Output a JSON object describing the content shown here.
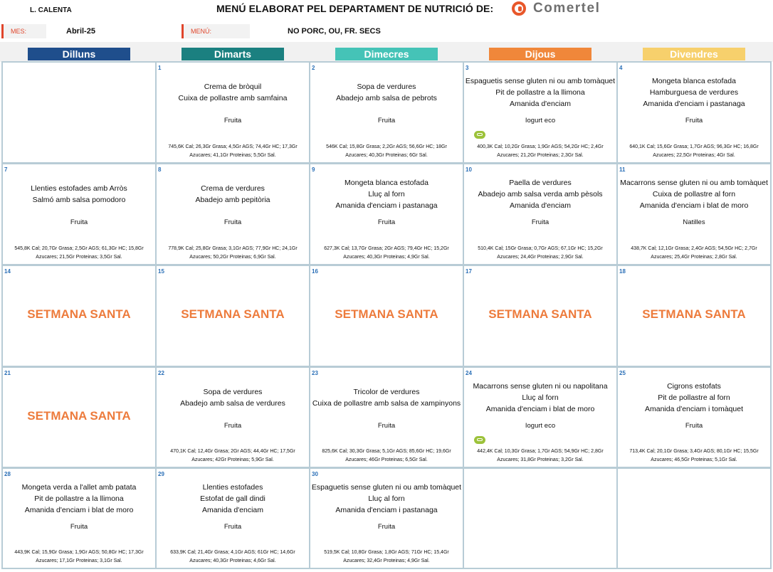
{
  "header": {
    "location": "L. CALENTA",
    "title": "MENÚ ELABORAT PEL DEPARTAMENT DE NUTRICIÓ DE:",
    "logo": "Comertel",
    "month_label": "MES:",
    "month_value": "Abril-25",
    "menu_label": "MENÚ:",
    "menu_value": "NO PORC, OU, FR. SECS"
  },
  "days": [
    {
      "label": "Dilluns",
      "color": "#1f4e8c"
    },
    {
      "label": "Dimarts",
      "color": "#1b8080"
    },
    {
      "label": "Dimecres",
      "color": "#45c3b7"
    },
    {
      "label": "Dijous",
      "color": "#f0873a"
    },
    {
      "label": "Divendres",
      "color": "#f7d06c"
    }
  ],
  "colors": {
    "holiday": "#ed7b3c",
    "day_number": "#2a6fb7",
    "accent": "#e0452b",
    "eco_badge": "#9cc23a"
  },
  "weeks": [
    [
      {
        "day": "",
        "dishes": [],
        "dessert": "",
        "nutrition": ""
      },
      {
        "day": "1",
        "dishes": [
          "Crema de bròquil",
          "Cuixa de pollastre amb samfaina"
        ],
        "dessert": "Fruita",
        "nutrition": "745,6K Cal; 26,3Gr Grasa; 4,5Gr AGS; 74,4Gr HC; 17,3Gr Azucares; 41,1Gr Proteinas; 5,5Gr Sal."
      },
      {
        "day": "2",
        "dishes": [
          "Sopa de verdures",
          "Abadejo amb salsa de pebrots"
        ],
        "dessert": "Fruita",
        "nutrition": "546K Cal; 15,8Gr Grasa; 2,2Gr AGS; 56,6Gr HC; 18Gr Azucares; 40,3Gr Proteinas; 6Gr Sal."
      },
      {
        "day": "3",
        "dishes": [
          "Espaguetis sense gluten ni ou amb tomàquet",
          "Pit de pollastre a la llimona",
          "Amanida d'enciam"
        ],
        "dessert": "Iogurt eco",
        "eco": true,
        "nutrition": "400,3K Cal; 10,2Gr Grasa; 1,9Gr AGS; 54,2Gr HC; 2,4Gr Azucares; 21,2Gr Proteinas; 2,3Gr Sal."
      },
      {
        "day": "4",
        "dishes": [
          "Mongeta blanca estofada",
          "Hamburguesa de verdures",
          "Amanida d'enciam i pastanaga"
        ],
        "dessert": "Fruita",
        "nutrition": "640,1K Cal; 15,6Gr Grasa; 1,7Gr AGS; 96,3Gr HC; 16,8Gr Azucares; 22,5Gr Proteinas; 4Gr Sal."
      }
    ],
    [
      {
        "day": "7",
        "dishes": [
          "Llenties estofades amb Arròs",
          "Salmó amb salsa pomodoro"
        ],
        "dessert": "Fruita",
        "nutrition": "545,8K Cal; 20,7Gr Grasa; 2,5Gr AGS; 61,3Gr HC; 15,8Gr Azucares; 21,5Gr Proteinas; 3,5Gr Sal."
      },
      {
        "day": "8",
        "dishes": [
          "Crema de verdures",
          "Abadejo amb pepitòria"
        ],
        "dessert": "Fruita",
        "nutrition": "778,9K Cal; 25,8Gr Grasa; 3,1Gr AGS; 77,9Gr HC; 24,1Gr Azucares; 50,2Gr Proteinas; 6,9Gr Sal."
      },
      {
        "day": "9",
        "dishes": [
          "Mongeta blanca estofada",
          "Lluç al forn",
          "Amanida d'enciam i pastanaga"
        ],
        "dessert": "Fruita",
        "nutrition": "627,3K Cal; 13,7Gr Grasa; 2Gr AGS; 79,4Gr HC; 15,2Gr Azucares; 40,3Gr Proteinas; 4,9Gr Sal."
      },
      {
        "day": "10",
        "dishes": [
          "Paella de verdures",
          "Abadejo amb salsa verda amb pèsols",
          "Amanida d'enciam"
        ],
        "dessert": "Fruita",
        "nutrition": "510,4K Cal; 15Gr Grasa; 0,7Gr AGS; 67,1Gr HC; 15,2Gr Azucares; 24,4Gr Proteinas; 2,9Gr Sal."
      },
      {
        "day": "11",
        "dishes": [
          "Macarrons sense gluten ni ou amb tomàquet",
          "Cuixa de pollastre al forn",
          "Amanida d'enciam i blat de moro"
        ],
        "dessert": "Natilles",
        "nutrition": "438,7K Cal; 12,1Gr Grasa; 2,4Gr AGS; 54,5Gr HC; 2,7Gr Azucares; 25,4Gr Proteinas; 2,8Gr Sal."
      }
    ],
    [
      {
        "day": "14",
        "holiday": "SETMANA SANTA"
      },
      {
        "day": "15",
        "holiday": "SETMANA SANTA"
      },
      {
        "day": "16",
        "holiday": "SETMANA SANTA"
      },
      {
        "day": "17",
        "holiday": "SETMANA SANTA"
      },
      {
        "day": "18",
        "holiday": "SETMANA SANTA"
      }
    ],
    [
      {
        "day": "21",
        "holiday": "SETMANA SANTA"
      },
      {
        "day": "22",
        "dishes": [
          "Sopa de verdures",
          "Abadejo amb salsa de verdures"
        ],
        "dessert": "Fruita",
        "nutrition": "470,1K Cal; 12,4Gr Grasa; 2Gr AGS; 44,4Gr HC; 17,5Gr Azucares; 42Gr Proteinas; 5,9Gr Sal."
      },
      {
        "day": "23",
        "dishes": [
          "Tricolor de verdures",
          "Cuixa de pollastre amb salsa de xampinyons"
        ],
        "dessert": "Fruita",
        "nutrition": "825,6K Cal; 30,3Gr Grasa; 5,1Gr AGS; 85,6Gr HC; 19,6Gr Azucares; 46Gr Proteinas; 6,5Gr Sal."
      },
      {
        "day": "24",
        "dishes": [
          "Macarrons sense gluten ni ou napolitana",
          "Lluç al forn",
          "Amanida d'enciam i blat de moro"
        ],
        "dessert": "Iogurt eco",
        "eco": true,
        "nutrition": "442,4K Cal; 10,3Gr Grasa; 1,7Gr AGS; 54,9Gr HC; 2,8Gr Azucares; 31,8Gr Proteinas; 3,2Gr Sal."
      },
      {
        "day": "25",
        "dishes": [
          "Cigrons estofats",
          "Pit de pollastre al forn",
          "Amanida d'enciam i tomàquet"
        ],
        "dessert": "Fruita",
        "nutrition": "713,4K Cal; 20,1Gr Grasa; 3,4Gr AGS; 80,1Gr HC; 15,5Gr Azucares; 46,5Gr Proteinas; 5,1Gr Sal."
      }
    ],
    [
      {
        "day": "28",
        "dishes": [
          "Mongeta verda a l'allet amb patata",
          "Pit de pollastre a la llimona",
          "Amanida d'enciam i blat de moro"
        ],
        "dessert": "Fruita",
        "nutrition": "443,9K Cal; 15,9Gr Grasa; 1,9Gr AGS; 50,8Gr HC; 17,3Gr Azucares; 17,1Gr Proteinas; 3,1Gr Sal."
      },
      {
        "day": "29",
        "dishes": [
          "Llenties estofades",
          "Estofat de gall dindi",
          "Amanida d'enciam"
        ],
        "dessert": "Fruita",
        "nutrition": "633,9K Cal; 21,4Gr Grasa; 4,1Gr AGS; 61Gr HC; 14,6Gr Azucares; 40,3Gr Proteinas; 4,6Gr Sal."
      },
      {
        "day": "30",
        "dishes": [
          "Espaguetis sense gluten ni ou amb tomàquet",
          "Lluç al forn",
          "Amanida d'enciam i pastanaga"
        ],
        "dessert": "Fruita",
        "nutrition": "519,5K Cal; 10,8Gr Grasa; 1,8Gr AGS; 71Gr HC; 15,4Gr Azucares; 32,4Gr Proteinas; 4,9Gr Sal."
      },
      {
        "day": "",
        "dishes": [],
        "dessert": "",
        "nutrition": ""
      },
      {
        "day": "",
        "dishes": [],
        "dessert": "",
        "nutrition": ""
      }
    ]
  ]
}
